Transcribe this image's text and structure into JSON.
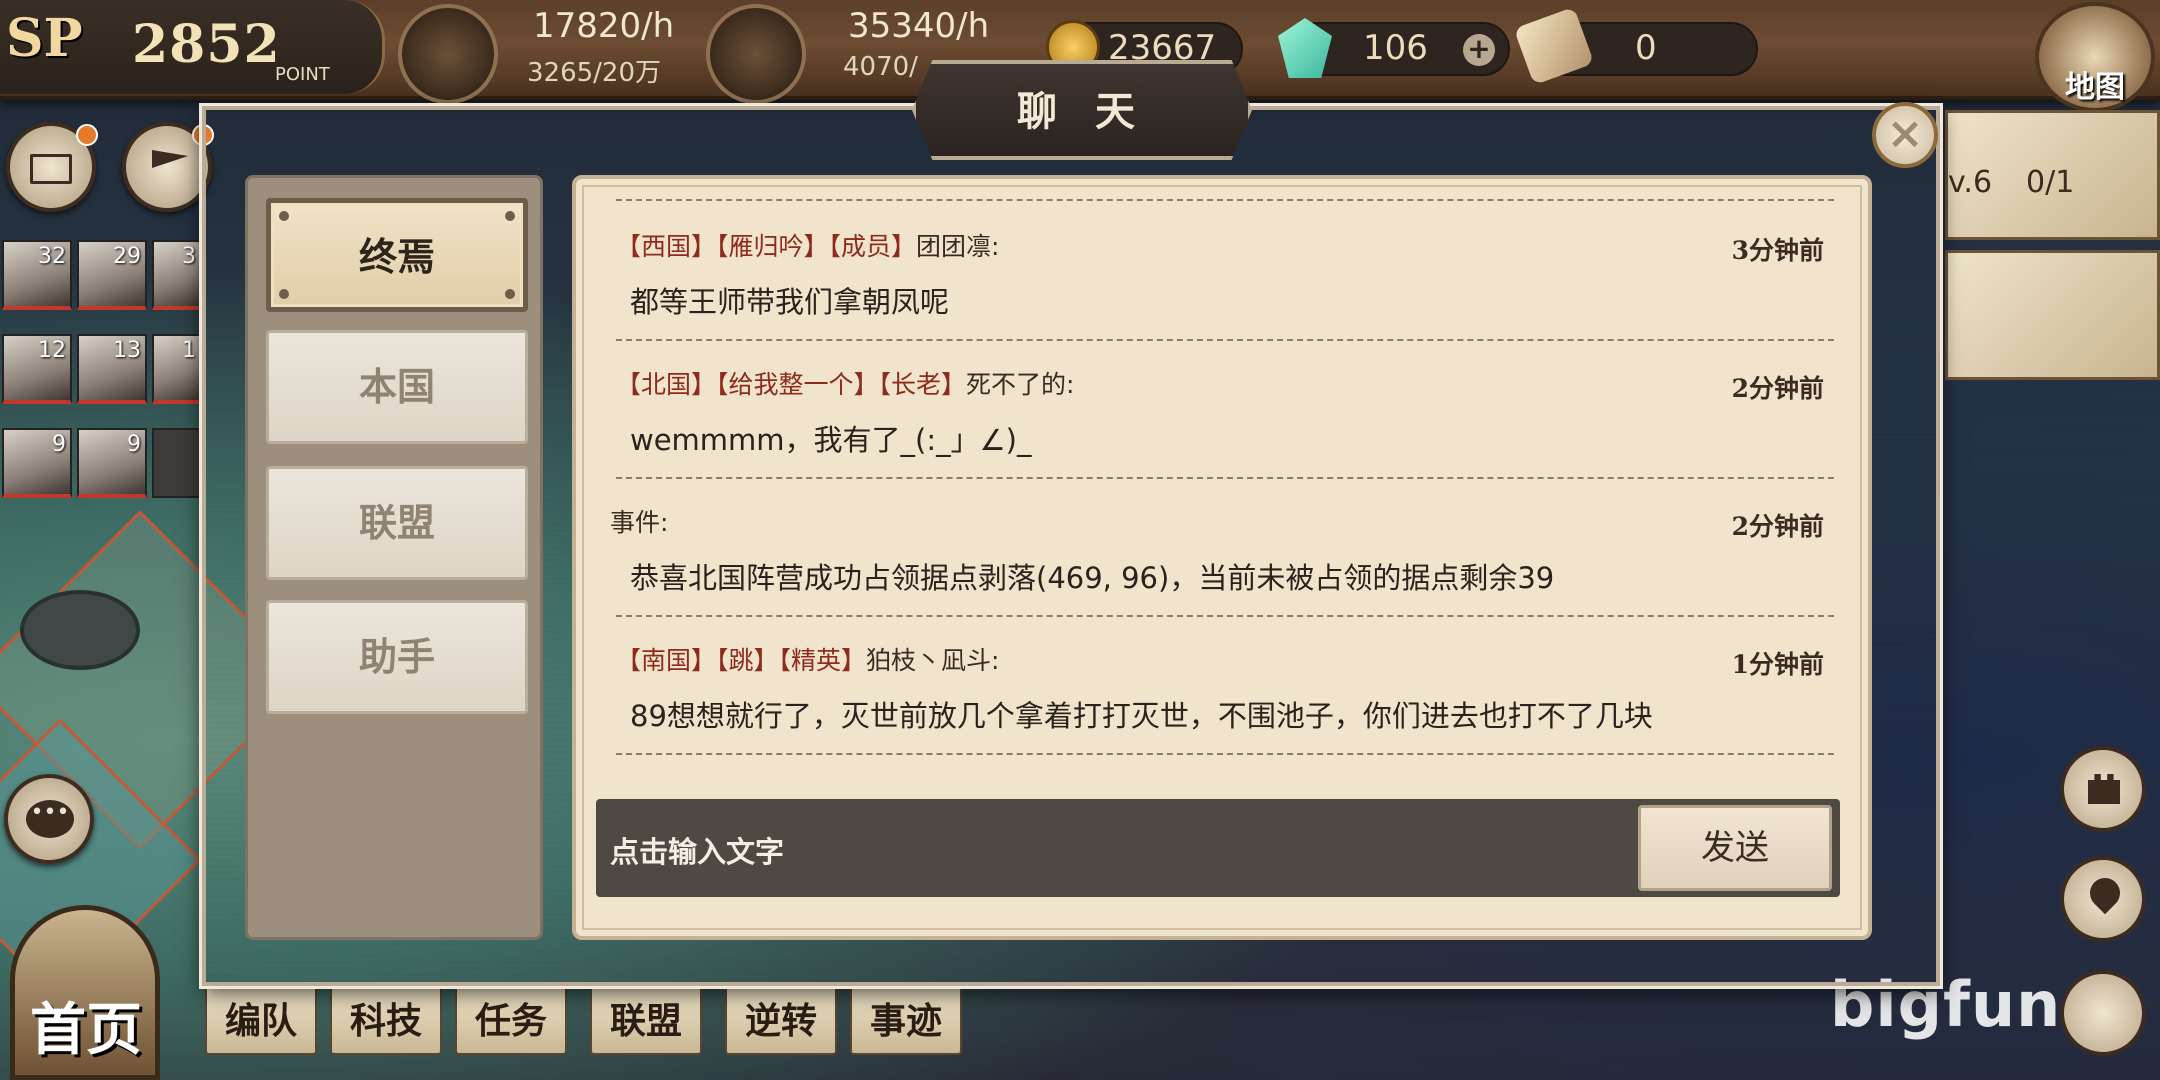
{
  "topbar": {
    "sp_label": "SP",
    "sp_value": "2852",
    "sp_unit": "POINT",
    "resource1": {
      "rate": "17820/h",
      "capacity": "3265/20万"
    },
    "resource2": {
      "rate": "35340/h",
      "capacity": "4070/"
    },
    "gold": "23667",
    "gems": "106",
    "scrolls": "0",
    "map_label": "地图"
  },
  "dialog": {
    "title": "聊 天",
    "close_icon": "close-icon",
    "tabs": [
      {
        "label": "终焉",
        "active": true
      },
      {
        "label": "本国",
        "active": false
      },
      {
        "label": "联盟",
        "active": false
      },
      {
        "label": "助手",
        "active": false
      }
    ],
    "messages": [
      {
        "prefix": "【西国】【雁归吟】【成员】",
        "name": "团团凛:",
        "time": "3分钟前",
        "body": "都等王师带我们拿朝凤呢"
      },
      {
        "prefix": "【北国】【给我整一个】【长老】",
        "name": "死不了的:",
        "time": "2分钟前",
        "body": "wemmmm，我有了_(:_」∠)_"
      },
      {
        "prefix": "",
        "name": "事件:",
        "time": "2分钟前",
        "body": "恭喜北国阵营成功占领据点剥落(469, 96)，当前未被占领的据点剩余39"
      },
      {
        "prefix": "【南国】【跳】【精英】",
        "name": "狛枝丶凪斗:",
        "time": "1分钟前",
        "body": "89想想就行了，灭世前放几个拿着打打灭世，不围池子，你们进去也打不了几块"
      }
    ],
    "input_placeholder": "点击输入文字",
    "send_label": "发送"
  },
  "side": {
    "hero_levels": [
      "32",
      "29",
      "3",
      "12",
      "13",
      "1",
      "9",
      "9"
    ],
    "right_panel_text": "v.6",
    "right_panel_progress": "0/1"
  },
  "nav": {
    "home": "首页",
    "items": [
      "编队",
      "科技",
      "任务",
      "联盟",
      "逆转",
      "事迹"
    ]
  },
  "watermark": "bigfun"
}
